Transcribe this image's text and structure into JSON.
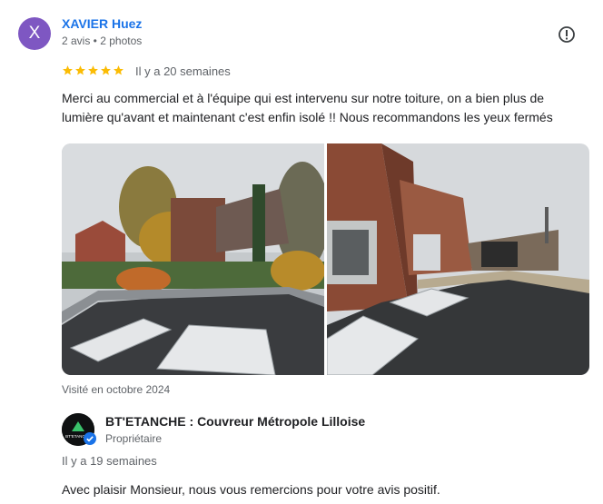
{
  "reviewer": {
    "initial": "X",
    "name": "XAVIER Huez",
    "meta": "2 avis • 2 photos",
    "avatar_color": "#7e57c2"
  },
  "actions": {
    "flag_icon": "report-flag-icon"
  },
  "rating": {
    "stars": 5,
    "max_stars": 5,
    "star_color": "#fbbc04",
    "time": "Il y a 20 semaines"
  },
  "review": {
    "text": "Merci au commercial et à l'équipe qui est intervenu sur notre toiture, on a bien plus de lumière qu'avant et maintenant c'est enfin isolé !! Nous recommandons les yeux fermés"
  },
  "photos": [
    {
      "name": "roof-photo-garden-view",
      "icon": "photo"
    },
    {
      "name": "roof-photo-brick-wall-view",
      "icon": "photo"
    }
  ],
  "visited": "Visité en octobre 2024",
  "owner": {
    "name": "BT'ETANCHE : Couvreur Métropole Lilloise",
    "role": "Propriétaire",
    "avatar_text": "BT'ETANCHE",
    "badge_icon": "verified-check-icon",
    "badge_color": "#1a73e8"
  },
  "response": {
    "time": "Il y a 19 semaines",
    "text": "Avec plaisir Monsieur, nous vous remercions pour votre avis positif."
  }
}
